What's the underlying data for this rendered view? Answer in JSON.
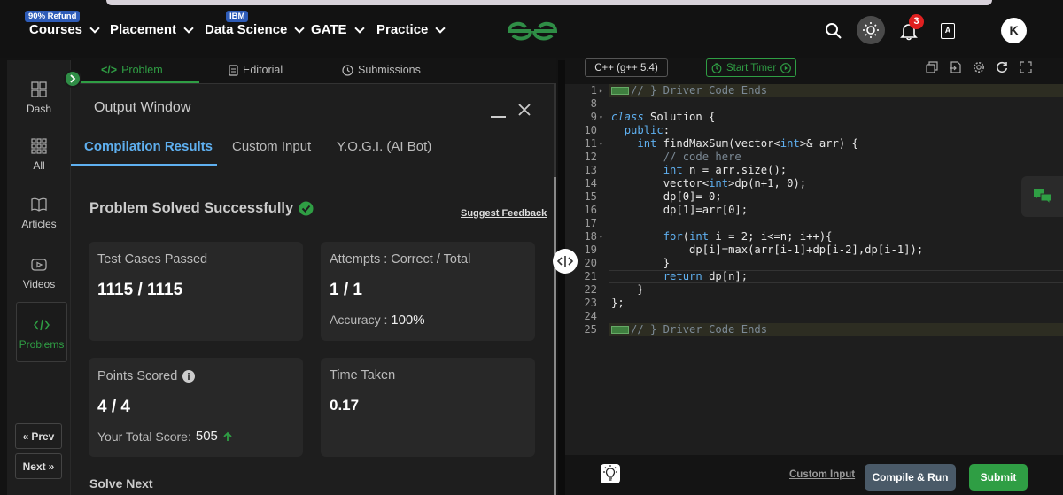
{
  "nav": {
    "courses_badge": "90% Refund",
    "courses": "Courses",
    "placement": "Placement",
    "ds_badge": "IBM",
    "data_science": "Data Science",
    "gate": "GATE",
    "practice": "Practice",
    "notification_count": "3",
    "avatar_initial": "K"
  },
  "rail": {
    "dash": "Dash",
    "all": "All",
    "articles": "Articles",
    "videos": "Videos",
    "problems": "Problems",
    "prev": "Prev",
    "next": "Next"
  },
  "problem_tabs": {
    "problem": "Problem",
    "editorial": "Editorial",
    "submissions": "Submissions"
  },
  "output_window": {
    "title": "Output Window",
    "tabs": [
      "Compilation Results",
      "Custom Input",
      "Y.O.G.I. (AI Bot)"
    ],
    "status": "Problem Solved Successfully",
    "suggest_feedback": "Suggest Feedback",
    "test_cases_label": "Test Cases Passed",
    "test_cases_value": "1115 / 1115",
    "attempts_label": "Attempts : Correct / Total",
    "attempts_value": "1 / 1",
    "accuracy_label": "Accuracy :",
    "accuracy_value": "100%",
    "points_label": "Points Scored",
    "points_value": "4 / 4",
    "total_score_label": "Your Total Score:",
    "total_score_value": "505",
    "time_label": "Time Taken",
    "time_value": "0.17",
    "solve_next": "Solve Next"
  },
  "editor": {
    "language": "C++ (g++ 5.4)",
    "start_timer": "Start Timer",
    "lines": [
      {
        "n": "1",
        "t": "// } Driver Code Ends"
      },
      {
        "n": "8",
        "t": ""
      },
      {
        "n": "9",
        "t": "class Solution {"
      },
      {
        "n": "10",
        "t": "  public:"
      },
      {
        "n": "11",
        "t": "    int findMaxSum(vector<int>& arr) {"
      },
      {
        "n": "12",
        "t": "        // code here"
      },
      {
        "n": "13",
        "t": "        int n = arr.size();"
      },
      {
        "n": "14",
        "t": "        vector<int>dp(n+1, 0);"
      },
      {
        "n": "15",
        "t": "        dp[0]= 0;"
      },
      {
        "n": "16",
        "t": "        dp[1]=arr[0];"
      },
      {
        "n": "17",
        "t": ""
      },
      {
        "n": "18",
        "t": "        for(int i = 2; i<=n; i++){"
      },
      {
        "n": "19",
        "t": "            dp[i]=max(arr[i-1]+dp[i-2],dp[i-1]);"
      },
      {
        "n": "20",
        "t": "        }"
      },
      {
        "n": "21",
        "t": "        return dp[n];"
      },
      {
        "n": "22",
        "t": "    }"
      },
      {
        "n": "23",
        "t": "};"
      },
      {
        "n": "24",
        "t": ""
      },
      {
        "n": "25",
        "t": "// } Driver Code Ends"
      }
    ],
    "custom_input": "Custom Input",
    "compile_run": "Compile & Run",
    "submit": "Submit"
  },
  "colors": {
    "brand_green": "#2f8d46",
    "accent_blue": "#5fb0f0",
    "submit_green": "#2f9e44",
    "compile_bg": "#4a5a68"
  }
}
